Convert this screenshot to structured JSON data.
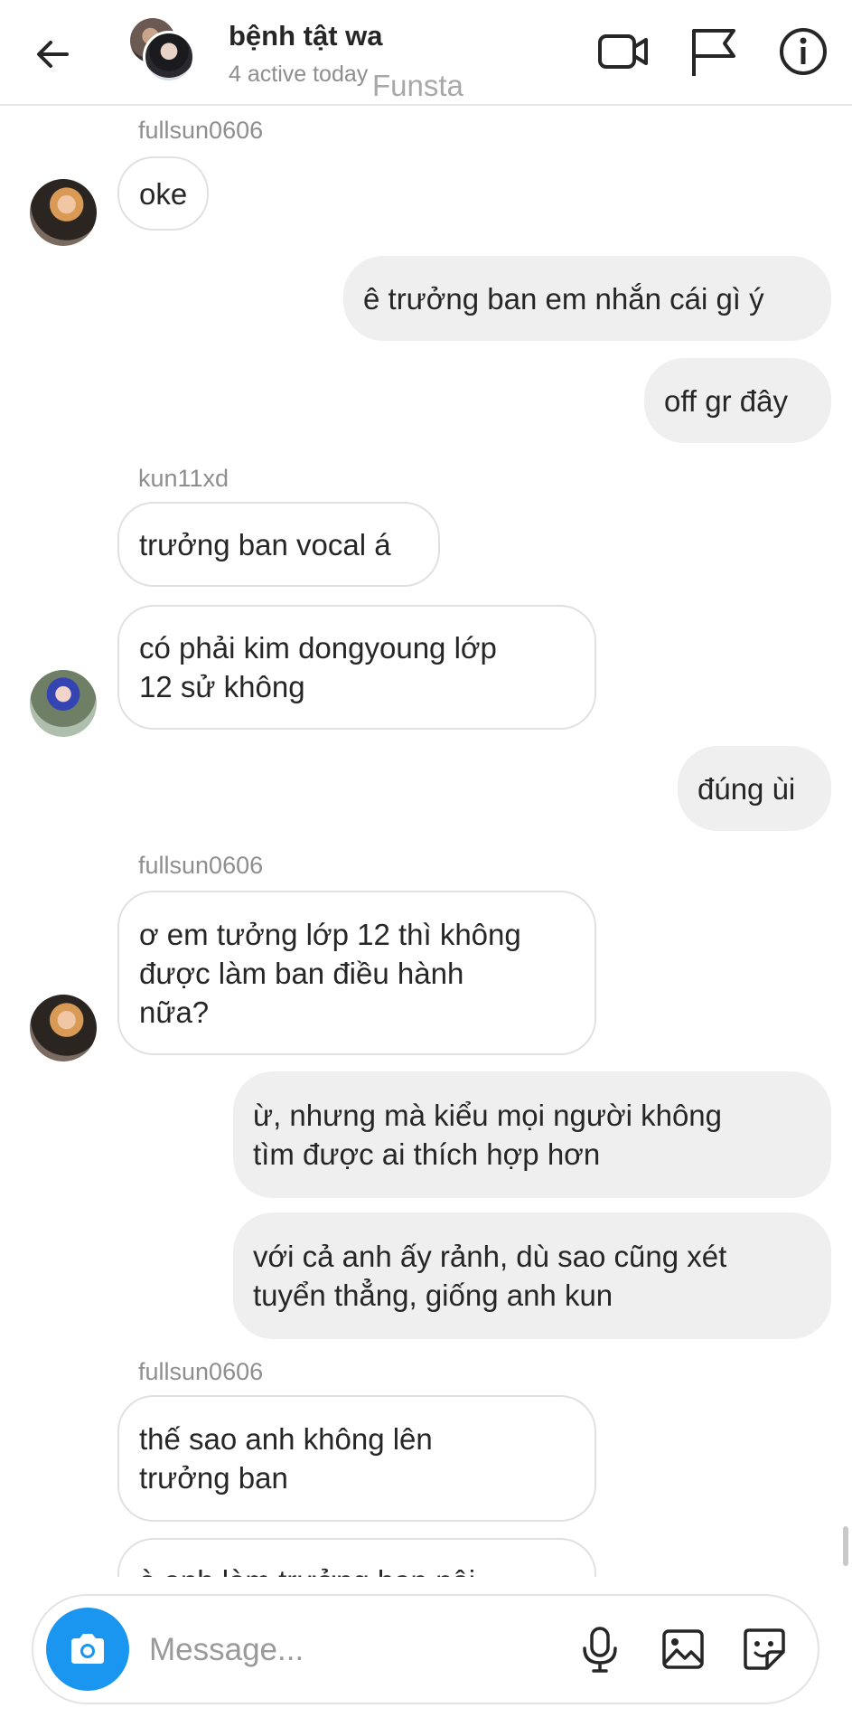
{
  "header": {
    "title": "bệnh tật wa",
    "subtitle": "4 active today",
    "watermark": "Funsta",
    "icons": [
      "back-arrow-icon",
      "video-call-icon",
      "flag-icon",
      "info-icon"
    ]
  },
  "messages": [
    {
      "sender": "fullsun0606",
      "text": "oke"
    },
    {
      "text": "ê trưởng ban em nhắn cái gì ý"
    },
    {
      "text": "off gr đây"
    },
    {
      "sender": "kun11xd",
      "text": "trưởng ban vocal á"
    },
    {
      "line1": "có phải kim dongyoung lớp",
      "line2": "12 sử không"
    },
    {
      "text": "đúng ùi"
    },
    {
      "sender": "fullsun0606",
      "line1": "ơ em tưởng lớp 12 thì không",
      "line2": "được làm ban điều hành",
      "line3": "nữa?"
    },
    {
      "line1": "ừ, nhưng mà kiểu mọi người không",
      "line2": "tìm được ai thích hợp hơn"
    },
    {
      "line1": "với cả anh ấy rảnh, dù sao cũng xét",
      "line2": "tuyển thẳng, giống anh kun"
    },
    {
      "sender": "fullsun0606",
      "line1": "thế sao anh không lên",
      "line2": "trưởng ban"
    },
    {
      "text": "à anh làm trưởng ban nội"
    }
  ],
  "composer": {
    "placeholder": "Message...",
    "camera_color": "#1a96f0",
    "icons": [
      "camera-icon",
      "microphone-icon",
      "gallery-icon",
      "sticker-icon"
    ]
  }
}
